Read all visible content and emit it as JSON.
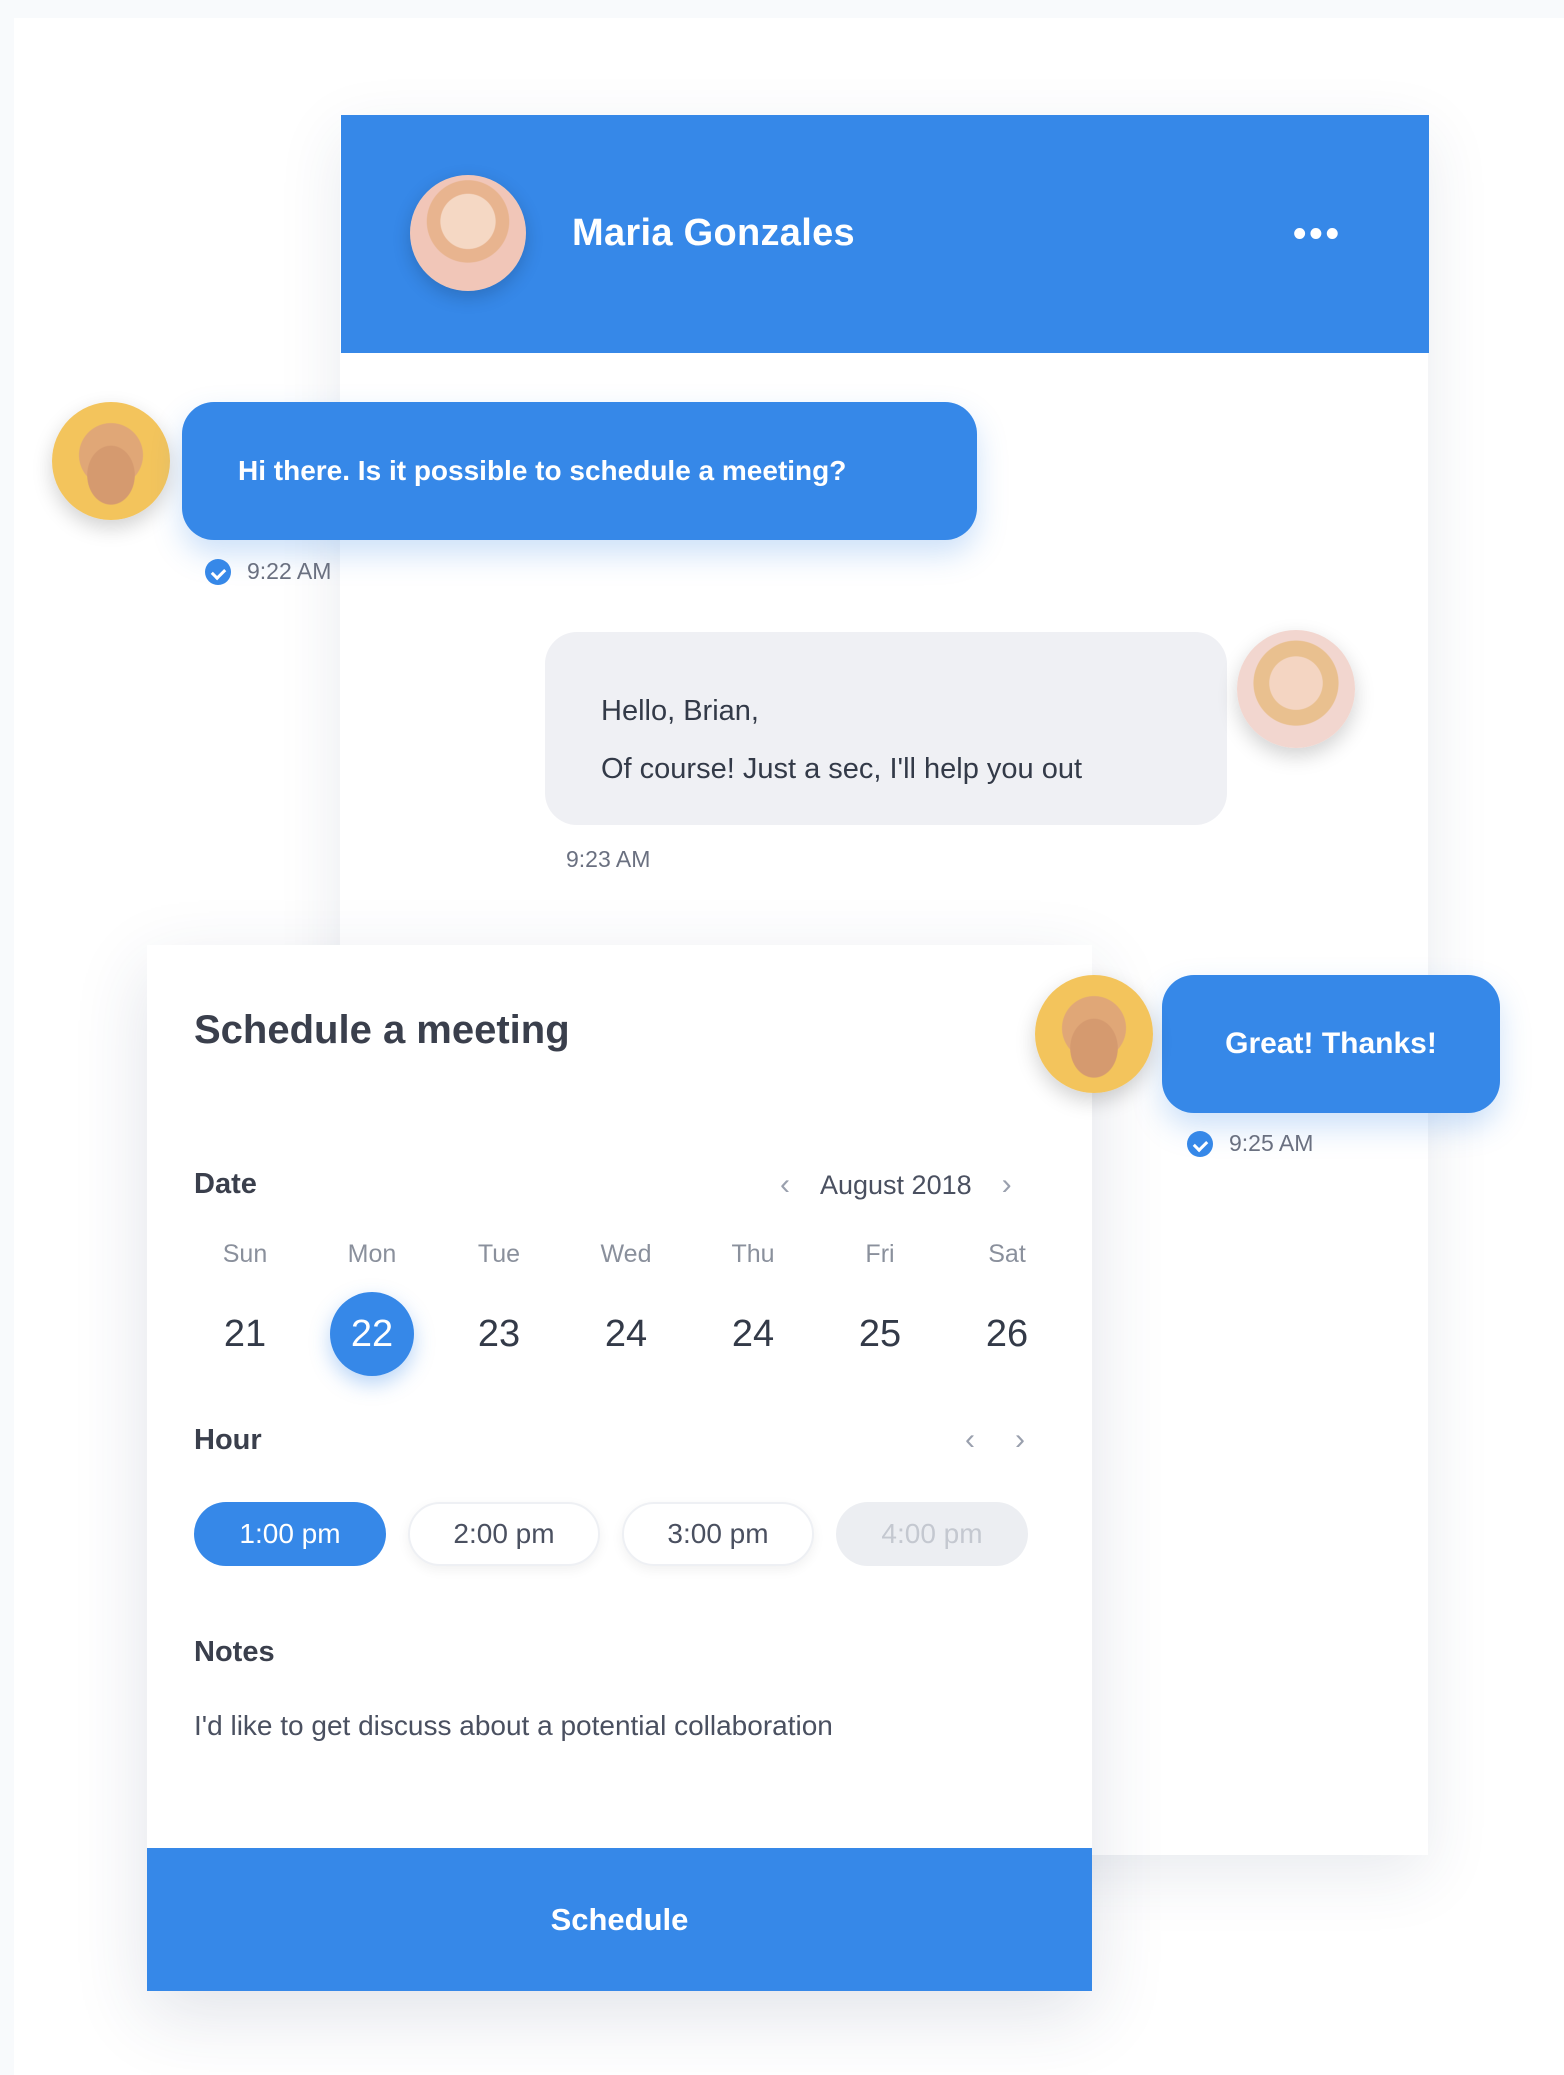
{
  "header": {
    "contact_name": "Maria Gonzales",
    "menu_icon": "more-horizontal-icon"
  },
  "messages": [
    {
      "sender": "Brian",
      "lines": [
        "Hi there. Is it possible to schedule a meeting?"
      ],
      "time": "9:22 AM",
      "read": true
    },
    {
      "sender": "Maria",
      "lines": [
        "Hello, Brian,",
        "Of course! Just a sec, I'll help you out"
      ],
      "time": "9:23 AM"
    },
    {
      "sender": "Brian",
      "lines": [
        "Great! Thanks!"
      ],
      "time": "9:25 AM",
      "read": true
    }
  ],
  "schedule": {
    "title": "Schedule a meeting",
    "date_label": "Date",
    "month": "August 2018",
    "days": [
      {
        "dow": "Sun",
        "num": "21"
      },
      {
        "dow": "Mon",
        "num": "22",
        "selected": true
      },
      {
        "dow": "Tue",
        "num": "23"
      },
      {
        "dow": "Wed",
        "num": "24"
      },
      {
        "dow": "Thu",
        "num": "24"
      },
      {
        "dow": "Fri",
        "num": "25"
      },
      {
        "dow": "Sat",
        "num": "26"
      }
    ],
    "hour_label": "Hour",
    "hours": [
      {
        "label": "1:00 pm",
        "state": "selected"
      },
      {
        "label": "2:00 pm",
        "state": "normal"
      },
      {
        "label": "3:00 pm",
        "state": "normal"
      },
      {
        "label": "4:00 pm",
        "state": "disabled"
      }
    ],
    "notes_label": "Notes",
    "notes_text": "I'd like to get discuss about a potential collaboration",
    "button_label": "Schedule"
  },
  "colors": {
    "accent": "#3688e8",
    "bubble_gray": "#eff0f4"
  }
}
